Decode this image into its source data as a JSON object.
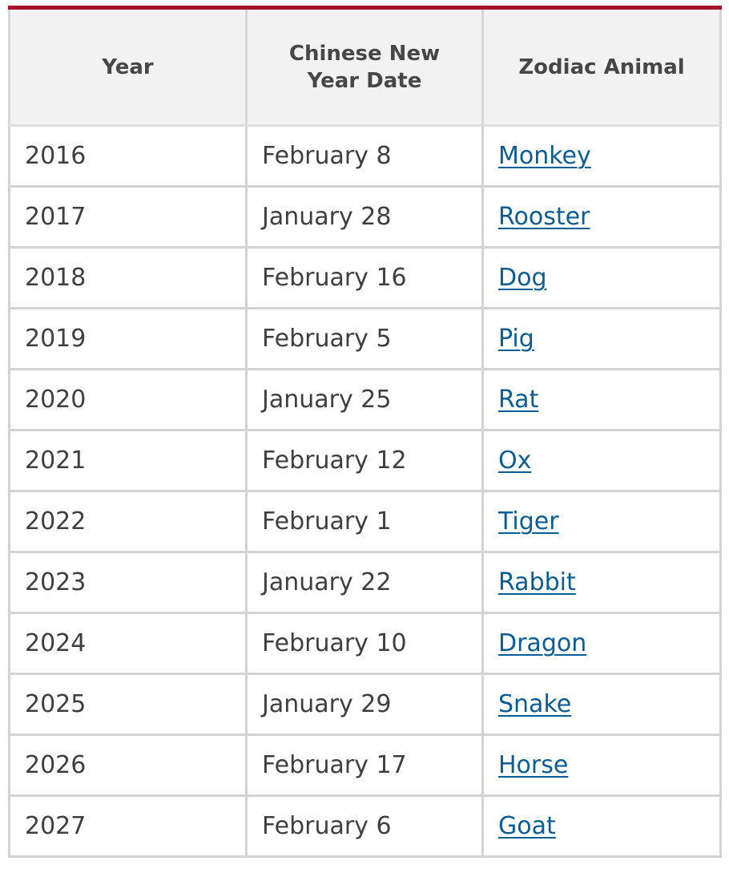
{
  "table": {
    "headers": [
      "Year",
      "Chinese New Year Date",
      "Zodiac Animal"
    ],
    "rows": [
      {
        "year": "2016",
        "date": "February 8",
        "animal": "Monkey"
      },
      {
        "year": "2017",
        "date": "January 28",
        "animal": "Rooster"
      },
      {
        "year": "2018",
        "date": "February 16",
        "animal": "Dog"
      },
      {
        "year": "2019",
        "date": "February 5",
        "animal": "Pig"
      },
      {
        "year": "2020",
        "date": "January 25",
        "animal": "Rat"
      },
      {
        "year": "2021",
        "date": "February 12",
        "animal": "Ox"
      },
      {
        "year": "2022",
        "date": "February 1",
        "animal": "Tiger"
      },
      {
        "year": "2023",
        "date": "January 22",
        "animal": "Rabbit"
      },
      {
        "year": "2024",
        "date": "February 10",
        "animal": "Dragon"
      },
      {
        "year": "2025",
        "date": "January 29",
        "animal": "Snake"
      },
      {
        "year": "2026",
        "date": "February 17",
        "animal": "Horse"
      },
      {
        "year": "2027",
        "date": "February 6",
        "animal": "Goat"
      }
    ]
  },
  "colors": {
    "accent": "#a5142a",
    "link": "#0b5d95",
    "header_bg": "#f2f2f2"
  }
}
